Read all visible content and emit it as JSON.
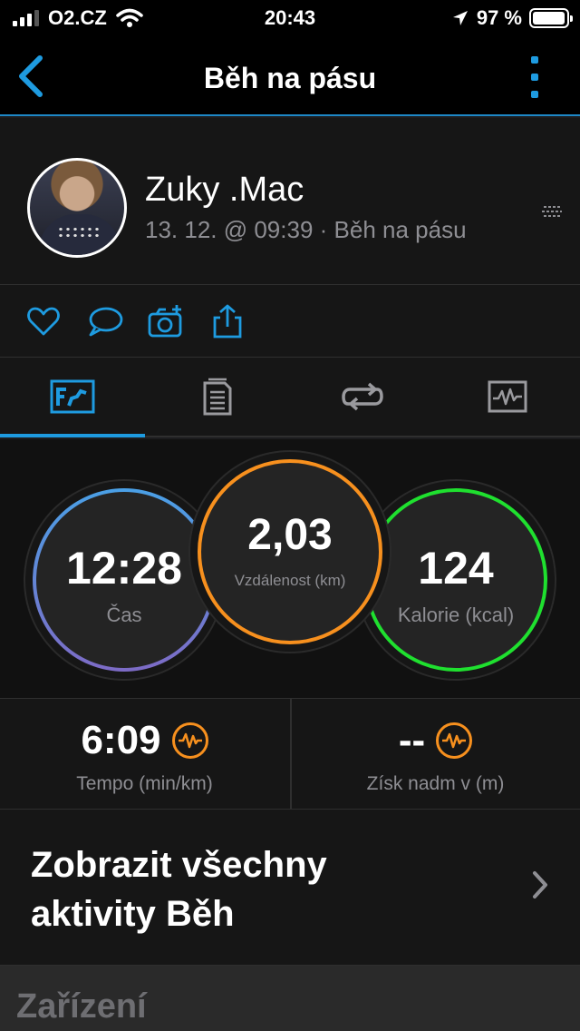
{
  "status_bar": {
    "carrier": "O2.CZ",
    "time": "20:43",
    "battery": "97 %",
    "battery_level": 0.97
  },
  "nav": {
    "title": "Běh na pásu",
    "back_icon": "chevron-left-icon",
    "more_icon": "more-vertical-icon"
  },
  "profile": {
    "name": "Zuky .Mac",
    "meta": "13. 12. @ 09:39 · Běh na pásu"
  },
  "actions": [
    "heart-icon",
    "comment-icon",
    "add-photo-icon",
    "share-icon"
  ],
  "tabs": [
    "overview-icon",
    "details-icon",
    "laps-icon",
    "charts-icon"
  ],
  "stats": {
    "time": {
      "value": "12:28",
      "label": "Čas"
    },
    "distance": {
      "value": "2,03",
      "label": "Vzdálenost (km)"
    },
    "calories": {
      "value": "124",
      "label": "Kalorie (kcal)"
    }
  },
  "metrics": {
    "pace": {
      "value": "6:09",
      "label": "Tempo (min/km)"
    },
    "elevation": {
      "value": "--",
      "label": "Získ nadm v (m)"
    }
  },
  "show_all": {
    "line1": "Zobrazit všechny",
    "line2": "aktivity Běh"
  },
  "devices": {
    "title": "Zařízení"
  },
  "colors": {
    "accent": "#1e9be0",
    "distance_ring": "#f7901e",
    "calories_ring": "#1fe02f",
    "time_ring_top": "#4aa0e6",
    "time_ring_bottom": "#7d6bc6"
  }
}
